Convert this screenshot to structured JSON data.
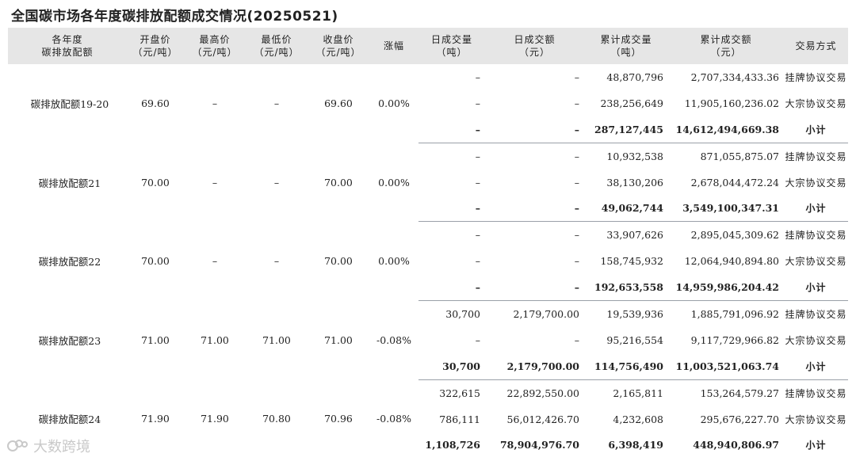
{
  "title": "全国碳市场各年度碳排放配额成交情况(20250521)",
  "headers": [
    {
      "l1": "各年度",
      "l2": "碳排放配额"
    },
    {
      "l1": "开盘价",
      "l2": "（元/吨）"
    },
    {
      "l1": "最高价",
      "l2": "（元/吨）"
    },
    {
      "l1": "最低价",
      "l2": "（元/吨）"
    },
    {
      "l1": "收盘价",
      "l2": "（元/吨）"
    },
    {
      "l1": "涨幅",
      "l2": ""
    },
    {
      "l1": "日成交量",
      "l2": "（吨）"
    },
    {
      "l1": "日成交额",
      "l2": "（元）"
    },
    {
      "l1": "累计成交量",
      "l2": "（吨）"
    },
    {
      "l1": "累计成交额",
      "l2": "（元）"
    },
    {
      "l1": "交易方式",
      "l2": ""
    }
  ],
  "groups": [
    {
      "name": "碳排放配额19-20",
      "open": "69.60",
      "high": "–",
      "low": "–",
      "close": "69.60",
      "change": "0.00%",
      "rows": [
        {
          "dvol": "–",
          "damt": "–",
          "cvol": "48,870,796",
          "camt": "2,707,334,433.36",
          "mode": "挂牌协议交易"
        },
        {
          "dvol": "–",
          "damt": "–",
          "cvol": "238,256,649",
          "camt": "11,905,160,236.02",
          "mode": "大宗协议交易"
        },
        {
          "dvol": "–",
          "damt": "–",
          "cvol": "287,127,445",
          "camt": "14,612,494,669.38",
          "mode": "小计"
        }
      ]
    },
    {
      "name": "碳排放配额21",
      "open": "70.00",
      "high": "–",
      "low": "–",
      "close": "70.00",
      "change": "0.00%",
      "rows": [
        {
          "dvol": "–",
          "damt": "–",
          "cvol": "10,932,538",
          "camt": "871,055,875.07",
          "mode": "挂牌协议交易"
        },
        {
          "dvol": "–",
          "damt": "–",
          "cvol": "38,130,206",
          "camt": "2,678,044,472.24",
          "mode": "大宗协议交易"
        },
        {
          "dvol": "–",
          "damt": "–",
          "cvol": "49,062,744",
          "camt": "3,549,100,347.31",
          "mode": "小计"
        }
      ]
    },
    {
      "name": "碳排放配额22",
      "open": "70.00",
      "high": "–",
      "low": "–",
      "close": "70.00",
      "change": "0.00%",
      "rows": [
        {
          "dvol": "–",
          "damt": "–",
          "cvol": "33,907,626",
          "camt": "2,895,045,309.62",
          "mode": "挂牌协议交易"
        },
        {
          "dvol": "–",
          "damt": "–",
          "cvol": "158,745,932",
          "camt": "12,064,940,894.80",
          "mode": "大宗协议交易"
        },
        {
          "dvol": "–",
          "damt": "–",
          "cvol": "192,653,558",
          "camt": "14,959,986,204.42",
          "mode": "小计"
        }
      ]
    },
    {
      "name": "碳排放配额23",
      "open": "71.00",
      "high": "71.00",
      "low": "71.00",
      "close": "71.00",
      "change": "-0.08%",
      "rows": [
        {
          "dvol": "30,700",
          "damt": "2,179,700.00",
          "cvol": "19,539,936",
          "camt": "1,885,791,096.92",
          "mode": "挂牌协议交易"
        },
        {
          "dvol": "–",
          "damt": "–",
          "cvol": "95,216,554",
          "camt": "9,117,729,966.82",
          "mode": "大宗协议交易"
        },
        {
          "dvol": "30,700",
          "damt": "2,179,700.00",
          "cvol": "114,756,490",
          "camt": "11,003,521,063.74",
          "mode": "小计"
        }
      ]
    },
    {
      "name": "碳排放配额24",
      "open": "71.90",
      "high": "71.90",
      "low": "70.80",
      "close": "70.96",
      "change": "-0.08%",
      "rows": [
        {
          "dvol": "322,615",
          "damt": "22,892,550.00",
          "cvol": "2,165,811",
          "camt": "153,264,579.27",
          "mode": "挂牌协议交易"
        },
        {
          "dvol": "786,111",
          "damt": "56,012,426.70",
          "cvol": "4,232,608",
          "camt": "295,676,227.70",
          "mode": "大宗协议交易"
        },
        {
          "dvol": "1,108,726",
          "damt": "78,904,976.70",
          "cvol": "6,398,419",
          "camt": "448,940,806.97",
          "mode": "小计"
        }
      ]
    }
  ],
  "watermark": "大数跨境"
}
